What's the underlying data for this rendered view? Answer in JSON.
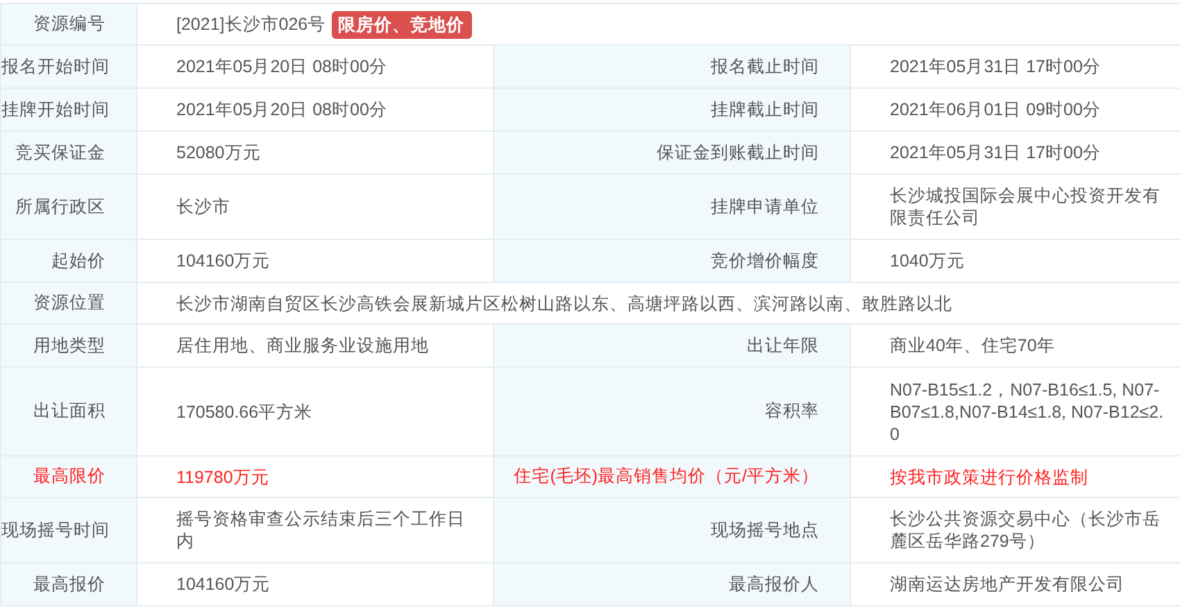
{
  "rows": [
    {
      "emphasis": false,
      "cells": [
        {
          "label": "资源编号",
          "value": "[2021]长沙市026号",
          "badge": "限房价、竞地价"
        }
      ]
    },
    {
      "emphasis": false,
      "cells": [
        {
          "label": "报名开始时间",
          "value": "2021年05月20日 08时00分"
        },
        {
          "label": "报名截止时间",
          "value": "2021年05月31日 17时00分"
        }
      ]
    },
    {
      "emphasis": false,
      "cells": [
        {
          "label": "挂牌开始时间",
          "value": "2021年05月20日 08时00分"
        },
        {
          "label": "挂牌截止时间",
          "value": "2021年06月01日 09时00分"
        }
      ]
    },
    {
      "emphasis": false,
      "cells": [
        {
          "label": "竞买保证金",
          "value": "52080万元"
        },
        {
          "label": "保证金到账截止时间",
          "value": "2021年05月31日 17时00分"
        }
      ]
    },
    {
      "emphasis": false,
      "cells": [
        {
          "label": "所属行政区",
          "value": "长沙市"
        },
        {
          "label": "挂牌申请单位",
          "value": "长沙城投国际会展中心投资开发有限责任公司"
        }
      ]
    },
    {
      "emphasis": false,
      "cells": [
        {
          "label": "起始价",
          "value": "104160万元"
        },
        {
          "label": "竞价增价幅度",
          "value": "1040万元"
        }
      ]
    },
    {
      "emphasis": false,
      "cells": [
        {
          "label": "资源位置",
          "value": "长沙市湖南自贸区长沙高铁会展新城片区松树山路以东、高塘坪路以西、滨河路以南、敢胜路以北"
        }
      ]
    },
    {
      "emphasis": false,
      "cells": [
        {
          "label": "用地类型",
          "value": "居住用地、商业服务业设施用地"
        },
        {
          "label": "出让年限",
          "value": "商业40年、住宅70年"
        }
      ]
    },
    {
      "emphasis": false,
      "cells": [
        {
          "label": "出让面积",
          "value": "170580.66平方米"
        },
        {
          "label": "容积率",
          "value": "N07-B15≤1.2，N07-B16≤1.5, N07-B07≤1.8,N07-B14≤1.8, N07-B12≤2.0"
        }
      ]
    },
    {
      "emphasis": true,
      "cells": [
        {
          "label": "最高限价",
          "value": "119780万元"
        },
        {
          "label": "住宅(毛坯)最高销售均价（元/平方米）",
          "value": "按我市政策进行价格监制"
        }
      ]
    },
    {
      "emphasis": false,
      "cells": [
        {
          "label": "现场摇号时间",
          "value": "摇号资格审查公示结束后三个工作日内"
        },
        {
          "label": "现场摇号地点",
          "value": "长沙公共资源交易中心（长沙市岳麓区岳华路279号）"
        }
      ]
    },
    {
      "emphasis": false,
      "cells": [
        {
          "label": "最高报价",
          "value": "104160万元"
        },
        {
          "label": "最高报价人",
          "value": "湖南运达房地产开发有限公司"
        }
      ]
    }
  ]
}
